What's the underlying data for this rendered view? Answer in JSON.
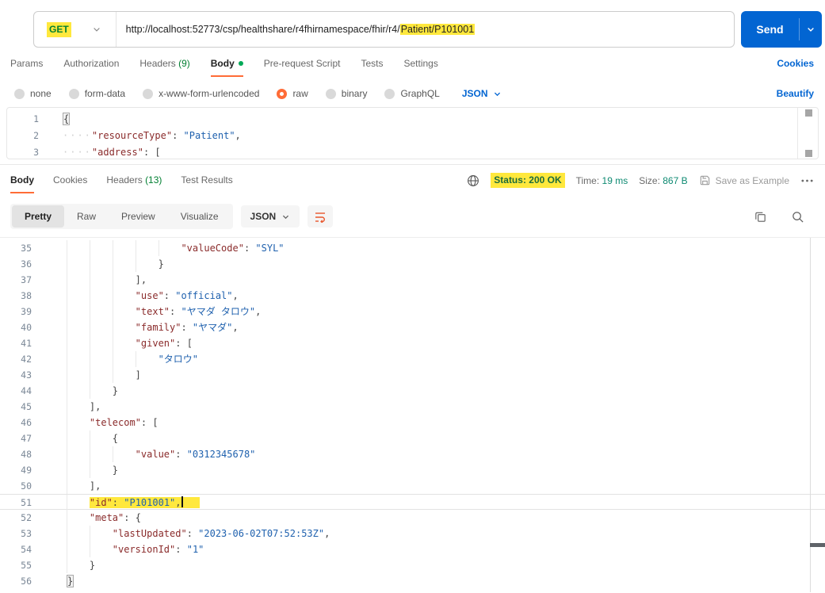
{
  "colors": {
    "accent_orange": "#FF6C37",
    "primary_blue": "#0265D2",
    "success_green": "#007F31",
    "marker_yellow": "#FFE83D",
    "json_key": "#8A2B2B",
    "json_string": "#1F61AE"
  },
  "request": {
    "method": "GET",
    "url_prefix": "http://localhost:52773/csp/healthshare/r4fhirnamespace/fhir/r4/",
    "url_highlight": "Patient/P101001",
    "send_label": "Send",
    "cookies_link": "Cookies",
    "tabs": [
      {
        "label": "Params"
      },
      {
        "label": "Authorization"
      },
      {
        "label": "Headers",
        "count": "(9)"
      },
      {
        "label": "Body",
        "active": true,
        "dot": true
      },
      {
        "label": "Pre-request Script"
      },
      {
        "label": "Tests"
      },
      {
        "label": "Settings"
      }
    ],
    "body_modes": [
      {
        "label": "none"
      },
      {
        "label": "form-data"
      },
      {
        "label": "x-www-form-urlencoded"
      },
      {
        "label": "raw",
        "selected": true
      },
      {
        "label": "binary"
      },
      {
        "label": "GraphQL"
      }
    ],
    "body_format": "JSON",
    "beautify_link": "Beautify",
    "editor_lines": [
      {
        "n": 1,
        "toks": [
          {
            "c": "pun",
            "t": "{",
            "box": true
          }
        ]
      },
      {
        "n": 2,
        "indent": 4,
        "dots": true,
        "toks": [
          {
            "c": "key",
            "t": "\"resourceType\""
          },
          {
            "c": "pun",
            "t": ": "
          },
          {
            "c": "str",
            "t": "\"Patient\""
          },
          {
            "c": "pun",
            "t": ","
          }
        ]
      },
      {
        "n": 3,
        "indent": 4,
        "dots": true,
        "toks": [
          {
            "c": "key",
            "t": "\"address\""
          },
          {
            "c": "pun",
            "t": ": "
          },
          {
            "c": "pun",
            "t": "["
          }
        ]
      }
    ]
  },
  "response": {
    "tabs": [
      {
        "label": "Body",
        "active": true
      },
      {
        "label": "Cookies"
      },
      {
        "label": "Headers",
        "count": "(13)"
      },
      {
        "label": "Test Results"
      }
    ],
    "status": "Status: 200 OK",
    "time_label": "Time:",
    "time_value": "19 ms",
    "size_label": "Size:",
    "size_value": "867 B",
    "save_as_example": "Save as Example",
    "view_tabs": [
      {
        "label": "Pretty",
        "active": true
      },
      {
        "label": "Raw"
      },
      {
        "label": "Preview"
      },
      {
        "label": "Visualize"
      }
    ],
    "format": "JSON",
    "code_lines": [
      {
        "n": 35,
        "indent": 20,
        "toks": [
          {
            "c": "key",
            "t": "\"valueCode\""
          },
          {
            "c": "pun",
            "t": ": "
          },
          {
            "c": "str",
            "t": "\"SYL\""
          }
        ]
      },
      {
        "n": 36,
        "indent": 16,
        "toks": [
          {
            "c": "pun",
            "t": "}"
          }
        ]
      },
      {
        "n": 37,
        "indent": 12,
        "toks": [
          {
            "c": "pun",
            "t": "],"
          }
        ]
      },
      {
        "n": 38,
        "indent": 12,
        "toks": [
          {
            "c": "key",
            "t": "\"use\""
          },
          {
            "c": "pun",
            "t": ": "
          },
          {
            "c": "str",
            "t": "\"official\""
          },
          {
            "c": "pun",
            "t": ","
          }
        ]
      },
      {
        "n": 39,
        "indent": 12,
        "toks": [
          {
            "c": "key",
            "t": "\"text\""
          },
          {
            "c": "pun",
            "t": ": "
          },
          {
            "c": "str",
            "t": "\"ヤマダ タロウ\""
          },
          {
            "c": "pun",
            "t": ","
          }
        ]
      },
      {
        "n": 40,
        "indent": 12,
        "toks": [
          {
            "c": "key",
            "t": "\"family\""
          },
          {
            "c": "pun",
            "t": ": "
          },
          {
            "c": "str",
            "t": "\"ヤマダ\""
          },
          {
            "c": "pun",
            "t": ","
          }
        ]
      },
      {
        "n": 41,
        "indent": 12,
        "toks": [
          {
            "c": "key",
            "t": "\"given\""
          },
          {
            "c": "pun",
            "t": ": "
          },
          {
            "c": "pun",
            "t": "["
          }
        ]
      },
      {
        "n": 42,
        "indent": 16,
        "toks": [
          {
            "c": "str",
            "t": "\"タロウ\""
          }
        ]
      },
      {
        "n": 43,
        "indent": 12,
        "toks": [
          {
            "c": "pun",
            "t": "]"
          }
        ]
      },
      {
        "n": 44,
        "indent": 8,
        "toks": [
          {
            "c": "pun",
            "t": "}"
          }
        ]
      },
      {
        "n": 45,
        "indent": 4,
        "toks": [
          {
            "c": "pun",
            "t": "],"
          }
        ]
      },
      {
        "n": 46,
        "indent": 4,
        "toks": [
          {
            "c": "key",
            "t": "\"telecom\""
          },
          {
            "c": "pun",
            "t": ": "
          },
          {
            "c": "pun",
            "t": "["
          }
        ]
      },
      {
        "n": 47,
        "indent": 8,
        "toks": [
          {
            "c": "pun",
            "t": "{"
          }
        ]
      },
      {
        "n": 48,
        "indent": 12,
        "toks": [
          {
            "c": "key",
            "t": "\"value\""
          },
          {
            "c": "pun",
            "t": ": "
          },
          {
            "c": "str",
            "t": "\"0312345678\""
          }
        ]
      },
      {
        "n": 49,
        "indent": 8,
        "toks": [
          {
            "c": "pun",
            "t": "}"
          }
        ]
      },
      {
        "n": 50,
        "indent": 4,
        "toks": [
          {
            "c": "pun",
            "t": "],"
          }
        ]
      },
      {
        "n": 51,
        "indent": 4,
        "current": true,
        "caret": true,
        "toks": [
          {
            "c": "key",
            "t": "\"id\"",
            "hl": true
          },
          {
            "c": "pun",
            "t": ": ",
            "hl": true
          },
          {
            "c": "str",
            "t": "\"P101001\"",
            "hl": true
          },
          {
            "c": "pun",
            "t": ",",
            "hl": true
          }
        ]
      },
      {
        "n": 52,
        "indent": 4,
        "toks": [
          {
            "c": "key",
            "t": "\"meta\""
          },
          {
            "c": "pun",
            "t": ": "
          },
          {
            "c": "pun",
            "t": "{"
          }
        ]
      },
      {
        "n": 53,
        "indent": 8,
        "toks": [
          {
            "c": "key",
            "t": "\"lastUpdated\""
          },
          {
            "c": "pun",
            "t": ": "
          },
          {
            "c": "str",
            "t": "\"2023-06-02T07:52:53Z\""
          },
          {
            "c": "pun",
            "t": ","
          }
        ]
      },
      {
        "n": 54,
        "indent": 8,
        "toks": [
          {
            "c": "key",
            "t": "\"versionId\""
          },
          {
            "c": "pun",
            "t": ": "
          },
          {
            "c": "str",
            "t": "\"1\""
          }
        ]
      },
      {
        "n": 55,
        "indent": 4,
        "toks": [
          {
            "c": "pun",
            "t": "}"
          }
        ]
      },
      {
        "n": 56,
        "indent": 0,
        "toks": [
          {
            "c": "pun",
            "t": "}",
            "box": true
          }
        ]
      }
    ]
  }
}
